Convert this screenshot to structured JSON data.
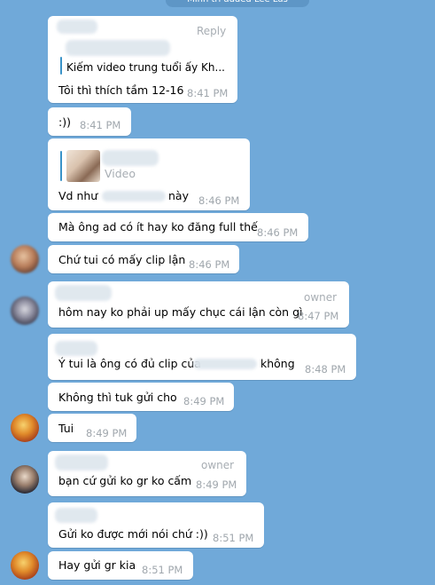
{
  "service_message": "Minh tri added Lee Lus",
  "messages": [
    {
      "reply_label": "Reply",
      "quote_text": "Kiếm video trung tuổi ấy  Kh...",
      "text": "Tôi thì thích tầm 12-16",
      "time": "8:41 PM"
    },
    {
      "text": ":))",
      "time": "8:41 PM"
    },
    {
      "quote_label": "Video",
      "text_before": "Vd như",
      "text_after": "này",
      "time": "8:46 PM"
    },
    {
      "text": "Mà ông ad có ít hay ko đăng full thế",
      "time": "8:46 PM"
    },
    {
      "text": "Chứ tui có mấy clip lận",
      "time": "8:46 PM"
    },
    {
      "tag": "owner",
      "text": "hôm nay ko phải up mấy chục cái lận còn gì",
      "time": "8:47 PM"
    },
    {
      "text_before": "Ý tui là ông có đủ clip của",
      "text_after": "không",
      "time": "8:48 PM"
    },
    {
      "text": "Không thì tuk gửi cho",
      "time": "8:49 PM"
    },
    {
      "text": "Tui",
      "time": "8:49 PM"
    },
    {
      "tag": "owner",
      "text": "bạn cứ gửi ko gr ko cấm",
      "time": "8:49 PM"
    },
    {
      "text": "Gửi ko được mới nói chứ :))",
      "time": "8:51 PM"
    },
    {
      "text": "Hay gửi gr kia",
      "time": "8:51 PM"
    }
  ]
}
